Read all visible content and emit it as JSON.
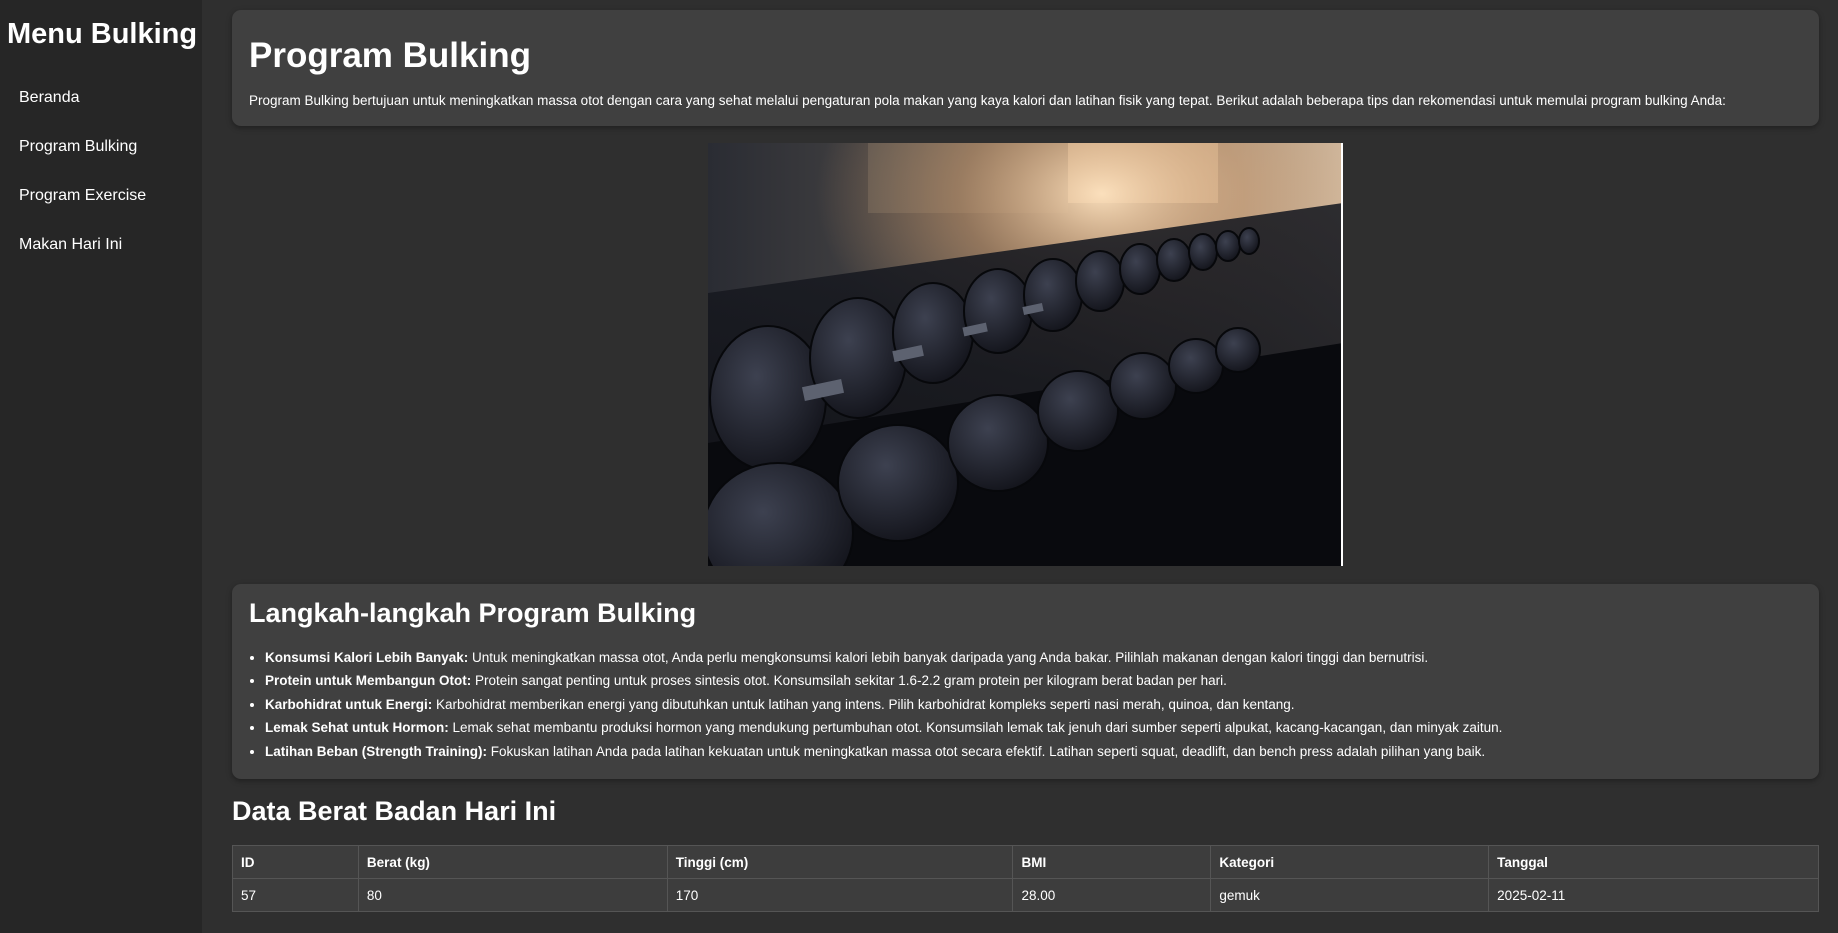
{
  "sidebar": {
    "title": "Menu Bulking",
    "items": [
      {
        "label": "Beranda"
      },
      {
        "label": "Program Bulking"
      },
      {
        "label": "Program Exercise"
      },
      {
        "label": "Makan Hari Ini"
      }
    ]
  },
  "intro": {
    "title": "Program Bulking",
    "text": "Program Bulking bertujuan untuk meningkatkan massa otot dengan cara yang sehat melalui pengaturan pola makan yang kaya kalori dan latihan fisik yang tepat. Berikut adalah beberapa tips dan rekomendasi untuk memulai program bulking Anda:"
  },
  "hero": {
    "subject": "dumbbell-rack-photo"
  },
  "steps": {
    "title": "Langkah-langkah Program Bulking",
    "items": [
      {
        "bold": "Konsumsi Kalori Lebih Banyak:",
        "text": " Untuk meningkatkan massa otot, Anda perlu mengkonsumsi kalori lebih banyak daripada yang Anda bakar. Pilihlah makanan dengan kalori tinggi dan bernutrisi."
      },
      {
        "bold": "Protein untuk Membangun Otot:",
        "text": " Protein sangat penting untuk proses sintesis otot. Konsumsilah sekitar 1.6-2.2 gram protein per kilogram berat badan per hari."
      },
      {
        "bold": "Karbohidrat untuk Energi:",
        "text": " Karbohidrat memberikan energi yang dibutuhkan untuk latihan yang intens. Pilih karbohidrat kompleks seperti nasi merah, quinoa, dan kentang."
      },
      {
        "bold": "Lemak Sehat untuk Hormon:",
        "text": " Lemak sehat membantu produksi hormon yang mendukung pertumbuhan otot. Konsumsilah lemak tak jenuh dari sumber seperti alpukat, kacang-kacangan, dan minyak zaitun."
      },
      {
        "bold": "Latihan Beban (Strength Training):",
        "text": " Fokuskan latihan Anda pada latihan kekuatan untuk meningkatkan massa otot secara efektif. Latihan seperti squat, deadlift, dan bench press adalah pilihan yang baik."
      }
    ]
  },
  "weight": {
    "title": "Data Berat Badan Hari Ini",
    "headers": [
      "ID",
      "Berat (kg)",
      "Tinggi (cm)",
      "BMI",
      "Kategori",
      "Tanggal"
    ],
    "rows": [
      [
        "57",
        "80",
        "170",
        "28.00",
        "gemuk",
        "2025-02-11"
      ]
    ]
  }
}
